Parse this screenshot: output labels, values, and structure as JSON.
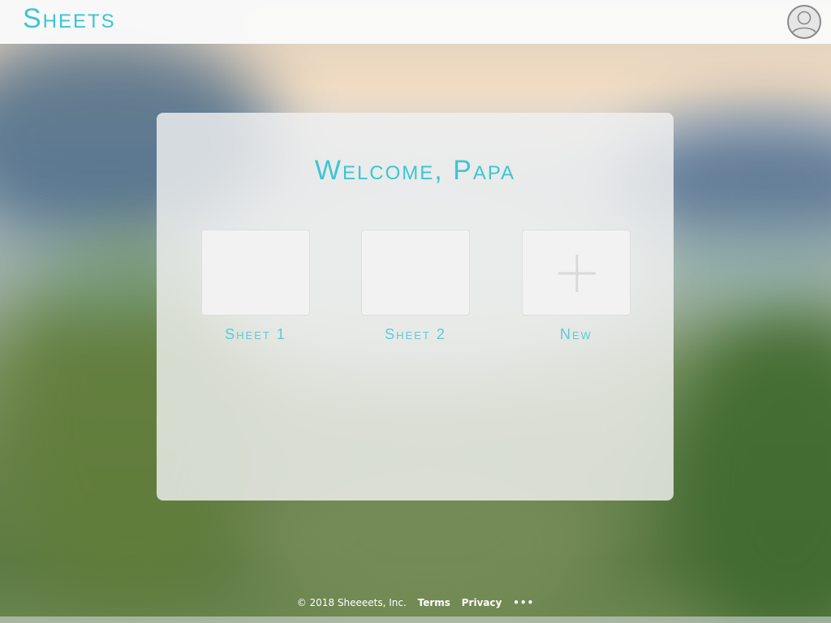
{
  "header": {
    "brand": "Sheets",
    "avatar_icon": "user-avatar-icon"
  },
  "main": {
    "welcome": "Welcome, Papa",
    "tiles": [
      {
        "label": "Sheet 1"
      },
      {
        "label": "Sheet 2"
      },
      {
        "label": "New",
        "icon": "plus-icon"
      }
    ]
  },
  "footer": {
    "copyright": "© 2018 Sheeeets, Inc.",
    "terms": "Terms",
    "privacy": "Privacy",
    "more": "•••"
  },
  "colors": {
    "accent": "#3bc6d3",
    "header_bg": "#fafafa",
    "card_bg": "#f0f0f0"
  }
}
